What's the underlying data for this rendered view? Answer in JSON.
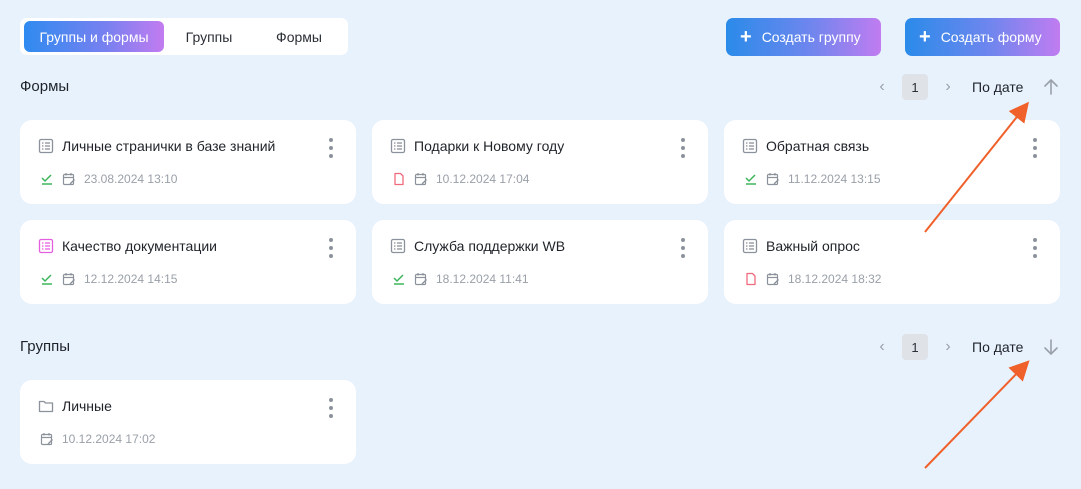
{
  "tabs": [
    {
      "label": "Группы и формы",
      "active": true
    },
    {
      "label": "Группы",
      "active": false
    },
    {
      "label": "Формы",
      "active": false
    }
  ],
  "actions": {
    "create_group": "Создать группу",
    "create_form": "Создать форму"
  },
  "forms_section": {
    "title": "Формы",
    "page": "1",
    "sort_label": "По дате",
    "sort_direction": "up",
    "cards": [
      {
        "title": "Личные странички в базе знаний",
        "date": "23.08.2024 13:10",
        "status": "published",
        "icon": "form-icon"
      },
      {
        "title": "Подарки к Новому году",
        "date": "10.12.2024 17:04",
        "status": "draft",
        "icon": "form-icon"
      },
      {
        "title": "Обратная связь",
        "date": "11.12.2024 13:15",
        "status": "published",
        "icon": "form-icon"
      },
      {
        "title": "Качество документации",
        "date": "12.12.2024 14:15",
        "status": "published",
        "icon": "form-icon-pink"
      },
      {
        "title": "Служба поддержки WB",
        "date": "18.12.2024 11:41",
        "status": "published",
        "icon": "form-icon"
      },
      {
        "title": "Важный опрос",
        "date": "18.12.2024 18:32",
        "status": "draft",
        "icon": "form-icon"
      }
    ]
  },
  "groups_section": {
    "title": "Группы",
    "page": "1",
    "sort_label": "По дате",
    "sort_direction": "down",
    "cards": [
      {
        "title": "Личные",
        "date": "10.12.2024 17:02",
        "icon": "folder-icon"
      }
    ]
  },
  "colors": {
    "background": "#e8f2fd",
    "accent_start": "#2a8be9",
    "accent_end": "#c07cf0",
    "published": "#3cb55a",
    "draft": "#f06a7d",
    "annotation_arrow": "#f0602a"
  }
}
